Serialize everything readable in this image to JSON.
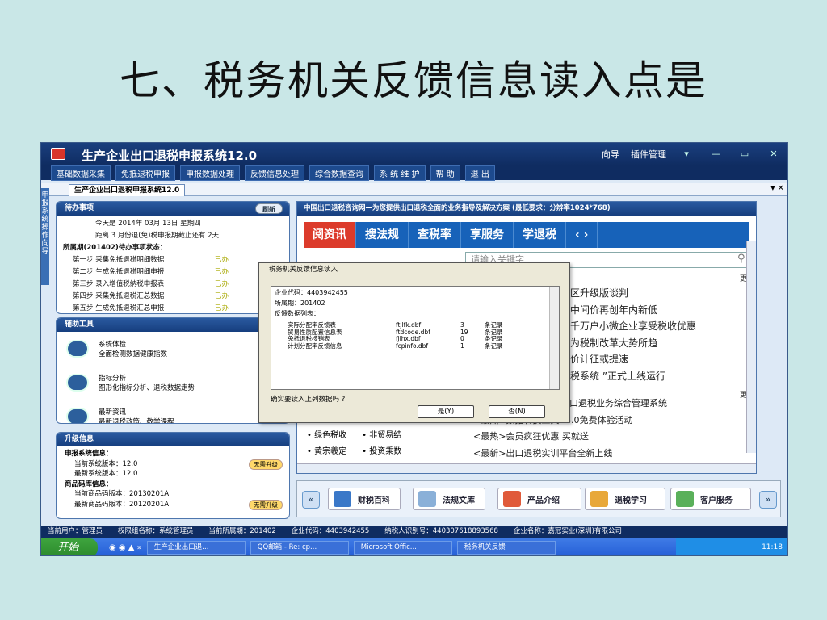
{
  "slide": {
    "title": "七、税务机关反馈信息读入点是"
  },
  "app": {
    "title": "生产企业出口退税申报系统12.0",
    "top_right": [
      "向导",
      "插件管理"
    ],
    "window_controls": [
      "▾",
      "—",
      "▭",
      "✕"
    ],
    "menu": [
      "基础数据采集",
      "免抵退税申报",
      "申报数据处理",
      "反馈信息处理",
      "综合数据查询",
      "系 统 维 护",
      "帮 助",
      "退 出"
    ],
    "doc_tab": "生产企业出口退税申报系统12.0",
    "doc_ctrl": "▾ ✕",
    "vertical_tab": "申报系统操作向导"
  },
  "todo": {
    "title": "待办事项",
    "refresh": "刷新",
    "date_line": "今天是 2014年 03月 13日 星期四",
    "deadline_line": "距离 3 月份退(免)税申报期截止还有 2天",
    "period": "所属期(201402)待办事项状态：",
    "steps": [
      {
        "label": "第一步  采集免抵退税明细数据",
        "status": "已办"
      },
      {
        "label": "第二步  生成免抵退税明细申报",
        "status": "已办"
      },
      {
        "label": "第三步  录入增值税纳税申报表",
        "status": "已办"
      },
      {
        "label": "第四步  采集免抵退税汇总数据",
        "status": "已办"
      },
      {
        "label": "第五步  生成免抵退税汇总申报",
        "status": "已办"
      }
    ]
  },
  "tools": {
    "title": "辅助工具",
    "items": [
      {
        "name": "系统体检",
        "desc": "全面检测数据健康指数",
        "link": "查"
      },
      {
        "name": "指标分析",
        "desc": "图形化指标分析、退税数据走势",
        "link": "查"
      },
      {
        "name": "最新资讯",
        "desc": "最新退税政策、教学课程",
        "link": "查"
      }
    ]
  },
  "upgrade": {
    "title": "升级信息",
    "sys_head": "申报系统信息：",
    "cur_sys": "当前系统版本：12.0",
    "latest_sys": "最新系统版本：12.0",
    "tag1": "无需升级",
    "code_head": "商品码库信息：",
    "cur_code": "当前商品码版本：20130201A",
    "latest_code": "最新商品码版本：20120201A",
    "tag2": "无需升级"
  },
  "right": {
    "header": "中国出口退税咨询网—为您提供出口退税全面的业务指导及解决方案 (最低要求：分辨率1024*768)",
    "tabs": [
      "阅资讯",
      "搜法规",
      "查税率",
      "享服务",
      "学退税"
    ],
    "search_placeholder": "请输入关键字",
    "more": "更多",
    "news1": [
      "贸区升级版谈判",
      "率中间价再创年内新低",
      "过千万户小微企业享受税收优惠",
      "成为税制改革大势所趋",
      "人价计征或提速",
      "办税系统 ”正式上线运行"
    ],
    "news2": [
      "出口退税业务综合管理系统",
      "<最热>数据转换工具V8.0免费体验活动",
      "<最热>会员疯狂优惠 买就送",
      "<最新>出口退税实训平台全新上线"
    ],
    "left_links": [
      [
        "绿色税收",
        "非贸易结"
      ],
      [
        "黄宗羲定",
        "投资乘数"
      ]
    ]
  },
  "toolbar": [
    "财税百科",
    "法规文库",
    "产品介绍",
    "退税学习",
    "客户服务"
  ],
  "status": {
    "user": "当前用户：管理员",
    "group": "权限组名称：系统管理员",
    "period": "当前所属期：201402",
    "code": "企业代码：4403942455",
    "taxno": "纳税人识别号：440307618893568",
    "company": "企业名称：嘉冠实业(深圳)有限公司"
  },
  "taskbar": {
    "start": "开始",
    "tasks": [
      "生产企业出口退...",
      "QQ邮箱 - Re: cp...",
      "Microsoft Offic...",
      "税务机关反馈"
    ],
    "time": "11:18"
  },
  "dialog": {
    "title": "税务机关反馈信息读入",
    "code": "企业代码：4403942455",
    "period": "所属期：201402",
    "list_head": "反馈数据列表：",
    "rows": [
      [
        "实际分配率反馈表",
        "ftjlfk.dbf",
        "3",
        "条记录"
      ],
      [
        "贸易性质配置信息表",
        "ftdcode.dbf",
        "19",
        "条记录"
      ],
      [
        "免抵退税核销表",
        "fjlhx.dbf",
        "0",
        "条记录"
      ],
      [
        "计划分配率反馈信息",
        "fcpinfo.dbf",
        "1",
        "条记录"
      ]
    ],
    "question": "确实要读入上列数据吗 ?",
    "yes": "是(Y)",
    "no": "否(N)"
  }
}
